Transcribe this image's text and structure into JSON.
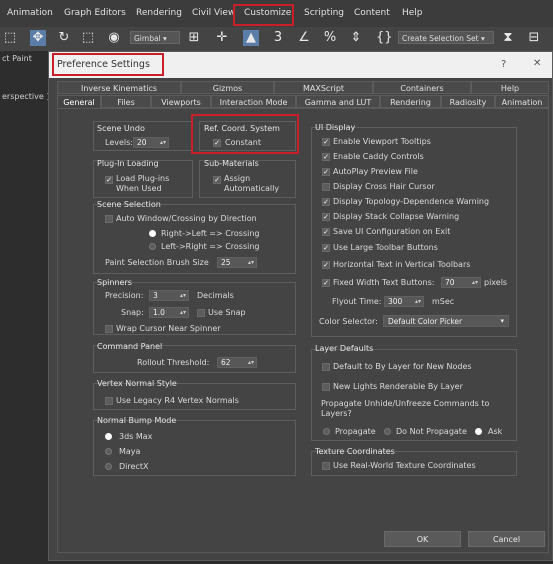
{
  "menubar": {
    "items": [
      "Animation",
      "Graph Editors",
      "Rendering",
      "Civil View",
      "Customize",
      "Scripting",
      "Content",
      "Help"
    ]
  },
  "toolbar": {
    "gimbal_label": "Gimbal",
    "selection_set_label": "Create Selection Set",
    "icons": [
      "select-region-icon",
      "move-icon",
      "rotate-icon",
      "select-window-icon",
      "paint-icon",
      "snaps-3d-icon",
      "angle-snap-icon",
      "percent-snap-icon",
      "spinner-snap-icon",
      "named-selection-icon",
      "mirror-icon",
      "align-icon"
    ]
  },
  "viewport": {
    "panel_label": "ct Paint",
    "viewport_label": "erspective ] ["
  },
  "dialog": {
    "title": "Preference Settings",
    "help_glyph": "?",
    "close_glyph": "✕",
    "tabs_row1": [
      "Inverse Kinematics",
      "Gizmos",
      "MAXScript",
      "Containers",
      "Help"
    ],
    "tabs_row2": [
      "General",
      "Files",
      "Viewports",
      "Interaction Mode",
      "Gamma and LUT",
      "Rendering",
      "Radiosity",
      "Animation"
    ],
    "scene_undo": {
      "title": "Scene Undo",
      "levels_label": "Levels:",
      "levels_value": "20"
    },
    "ref_coord": {
      "title": "Ref. Coord. System",
      "constant_label": "Constant",
      "constant_checked": true
    },
    "plugin_loading": {
      "title": "Plug-In Loading",
      "load_label_1": "Load Plug-ins",
      "load_label_2": "When Used"
    },
    "sub_materials": {
      "title": "Sub-Materials",
      "assign_label_1": "Assign",
      "assign_label_2": "Automatically"
    },
    "scene_selection": {
      "title": "Scene Selection",
      "auto_window": "Auto Window/Crossing by Direction",
      "rl_crossing": "Right->Left => Crossing",
      "lr_crossing": "Left->Right => Crossing",
      "brush_label": "Paint Selection Brush Size",
      "brush_value": "25"
    },
    "spinners": {
      "title": "Spinners",
      "precision_label": "Precision:",
      "precision_value": "3",
      "decimals_label": "Decimals",
      "snap_label": "Snap:",
      "snap_value": "1.0",
      "use_snap": "Use Snap",
      "wrap_cursor": "Wrap Cursor Near Spinner"
    },
    "command_panel": {
      "title": "Command Panel",
      "rollout_label": "Rollout Threshold:",
      "rollout_value": "62"
    },
    "vertex_normal": {
      "title": "Vertex Normal Style",
      "legacy_label": "Use Legacy R4 Vertex Normals"
    },
    "normal_bump": {
      "title": "Normal Bump Mode",
      "options": [
        "3ds Max",
        "Maya",
        "DirectX"
      ]
    },
    "ui_display": {
      "title": "UI Display",
      "options": [
        {
          "label": "Enable Viewport Tooltips",
          "checked": true
        },
        {
          "label": "Enable Caddy Controls",
          "checked": true
        },
        {
          "label": "AutoPlay Preview File",
          "checked": true
        },
        {
          "label": "Display Cross Hair Cursor",
          "checked": false
        },
        {
          "label": "Display Topology-Dependence Warning",
          "checked": true
        },
        {
          "label": "Display Stack Collapse Warning",
          "checked": true
        },
        {
          "label": "Save UI Configuration on Exit",
          "checked": true
        },
        {
          "label": "Use Large Toolbar Buttons",
          "checked": true
        },
        {
          "label": "Horizontal Text in Vertical Toolbars",
          "checked": true
        }
      ],
      "fixed_width_label": "Fixed Width Text Buttons:",
      "fixed_width_value": "70",
      "pixels_label": "pixels",
      "flyout_label": "Flyout Time:",
      "flyout_value": "300",
      "msec_label": "mSec",
      "color_selector_label": "Color Selector:",
      "color_selector_value": "Default Color Picker"
    },
    "layer_defaults": {
      "title": "Layer Defaults",
      "default_bylayer": "Default to By Layer for New Nodes",
      "new_lights": "New Lights Renderable By Layer",
      "propagate_question_1": "Propagate Unhide/Unfreeze Commands to",
      "propagate_question_2": "Layers?",
      "propagate_options": [
        "Propagate",
        "Do Not Propagate",
        "Ask"
      ]
    },
    "texture_coords": {
      "title": "Texture Coordinates",
      "real_world": "Use Real-World Texture Coordinates"
    },
    "ok_label": "OK",
    "cancel_label": "Cancel"
  },
  "colors": {
    "highlight_red": "#c8202a",
    "dialog_bg": "#444444",
    "titlebar_bg": "#f0f0f0"
  }
}
